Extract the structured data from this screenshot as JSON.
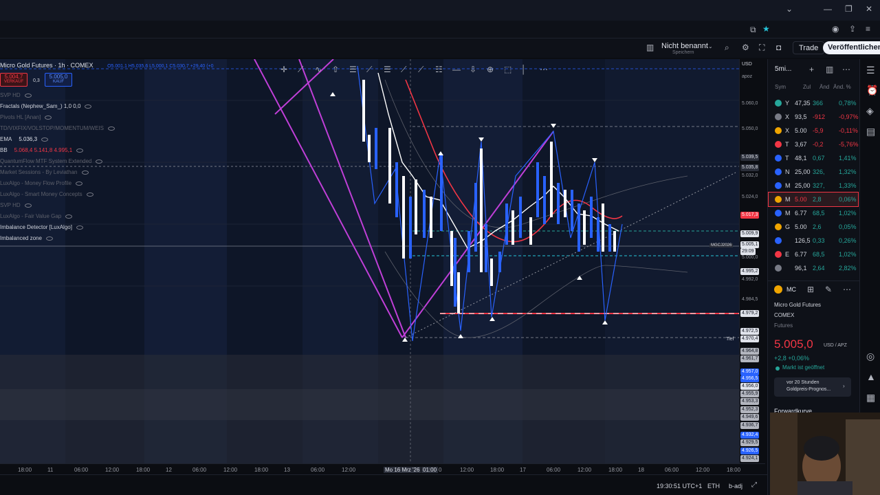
{
  "window": {
    "controls": [
      "⌄",
      "—",
      "❐",
      "✕"
    ]
  },
  "header": {
    "layout_name": "Nicht benannt",
    "layout_sub": "Speichern",
    "trade_label": "Trade",
    "publish_label": "Veröffentlichen"
  },
  "legend": {
    "symbol": "Micro Gold Futures · 1h · COMEX",
    "ohlc": "O5.001,1  H5.035,6  L5.000,1  C5.030,7 +29,40 (+0",
    "sell_price": "5.004,7",
    "sell_label": "VERKAUF",
    "spread": "0,3",
    "buy_price": "5.005,0",
    "buy_label": "KAUF"
  },
  "indicators": [
    {
      "label": "SVP HD",
      "dim": true
    },
    {
      "label": "Fractals (Nephew_Sam_)  1,0  0,0",
      "dim": false
    },
    {
      "label": "Pivots HL [Anan]",
      "dim": true
    },
    {
      "label": "TD/VIXFIX/VOLSTOP/MOMENTUM/WEIS",
      "dim": true
    },
    {
      "label": "EMA",
      "value": "5.036,3",
      "dim": false
    },
    {
      "label": "BB",
      "value": "5.068,4  5.141,8  4.995,1",
      "dim": false
    },
    {
      "label": "QuantumFlow MTF System Extended",
      "dim": true
    },
    {
      "label": "Market Sessions - By Leviathan",
      "dim": true
    },
    {
      "label": "LuxAlgo - Money Flow Profile",
      "dim": true
    },
    {
      "label": "LuxAlgo - Smart Money Concepts",
      "dim": true
    },
    {
      "label": "SVP HD",
      "dim": true
    },
    {
      "label": "LuxAlgo - Fair Value Gap",
      "dim": true
    },
    {
      "label": "Imbalance Detector [LuxAlgo]",
      "dim": false
    },
    {
      "label": "Imbalanced zone",
      "dim": false
    }
  ],
  "price_axis": {
    "currency": "USD",
    "unit": "apoz",
    "labels": [
      "5.060,0",
      "5.050,0",
      "5.039,5",
      "5.035,8",
      "5.032,0",
      "5.024,0",
      "5.017,3",
      "5.009,9",
      "5.005,1",
      "29:09",
      "5.000,0",
      "4.995,2",
      "4.992,0",
      "4.984,5",
      "4.979,2",
      "4.972,5",
      "4.970,4",
      "4.964,8",
      "4.961,7",
      "4.957,0",
      "4.956,5",
      "4.956,0",
      "4.955,9",
      "4.953,3",
      "4.952,3",
      "4.949,6",
      "4.936,7",
      "4.932,4",
      "4.929,5",
      "4.926,5",
      "4.924,1"
    ],
    "tief_label": "Tief",
    "contract_label": "MGCJ2026"
  },
  "time_axis": {
    "labels": [
      "18:00",
      "11",
      "06:00",
      "12:00",
      "18:00",
      "12",
      "06:00",
      "12:00",
      "18:00",
      "13",
      "06:00",
      "12:00",
      "Mo 16 Mrz '26",
      "01:00",
      "0",
      "12:00",
      "18:00",
      "17",
      "06:00",
      "12:00",
      "18:00",
      "18",
      "06:00",
      "12:00",
      "18:00"
    ]
  },
  "statusbar": {
    "time": "19:30:51 UTC+1",
    "session": "ETH",
    "adj": "b-adj"
  },
  "watchlist": {
    "title": "5mi...",
    "columns": [
      "Sym",
      "Zul",
      "Änd",
      "Änd. %"
    ],
    "rows": [
      {
        "sym": "Y",
        "last": "47,35",
        "chg": "366",
        "pct": "0,78%",
        "up": true,
        "color": "#26a69a"
      },
      {
        "sym": "X",
        "last": "93,5",
        "chg": "-912",
        "pct": "-0,97%",
        "up": false,
        "color": "#787b86"
      },
      {
        "sym": "X",
        "last": "5.00",
        "chg": "-5,9",
        "pct": "-0,11%",
        "up": false,
        "color": "#f0a500"
      },
      {
        "sym": "T",
        "last": "3,67",
        "chg": "-0,2",
        "pct": "-5,76%",
        "up": false,
        "color": "#f23645"
      },
      {
        "sym": "T",
        "last": "48,1",
        "chg": "0,67",
        "pct": "1,41%",
        "up": true,
        "color": "#2962ff"
      },
      {
        "sym": "N",
        "last": "25,00",
        "chg": "326,",
        "pct": "1,32%",
        "up": true,
        "color": "#2962ff"
      },
      {
        "sym": "M",
        "last": "25,00",
        "chg": "327,",
        "pct": "1,33%",
        "up": true,
        "color": "#2962ff"
      },
      {
        "sym": "M",
        "last": "5.00",
        "chg": "2,8",
        "pct": "0,06%",
        "up": true,
        "color": "#f0a500"
      },
      {
        "sym": "M",
        "last": "6.77",
        "chg": "68,5",
        "pct": "1,02%",
        "up": true,
        "color": "#2962ff"
      },
      {
        "sym": "G",
        "last": "5.00",
        "chg": "2,6",
        "pct": "0,05%",
        "up": true,
        "color": "#f0a500"
      },
      {
        "sym": "",
        "last": "126,5",
        "chg": "0,33",
        "pct": "0,26%",
        "up": true,
        "color": "#2962ff"
      },
      {
        "sym": "E",
        "last": "6.77",
        "chg": "68,5",
        "pct": "1,02%",
        "up": true,
        "color": "#f23645"
      },
      {
        "sym": "",
        "last": "96,1",
        "chg": "2,64",
        "pct": "2,82%",
        "up": true,
        "color": "#787b86"
      }
    ]
  },
  "details": {
    "badge": "MC",
    "name": "Micro Gold Futures",
    "exchange": "COMEX",
    "type": "Futures",
    "price": "5.005,0",
    "unit": "USD / APZ",
    "change": "+2,8  +0,06%",
    "market_status": "Markt ist geöffnet",
    "news_line1": "vor 20 Stunden",
    "news_line2": "Goldpreis-Prognos...",
    "section": "Forwardkurve"
  },
  "colors": {
    "up": "#26a69a",
    "down": "#f23645",
    "accent": "#2962ff",
    "magenta": "#c03fd8",
    "gold": "#f0a500"
  }
}
